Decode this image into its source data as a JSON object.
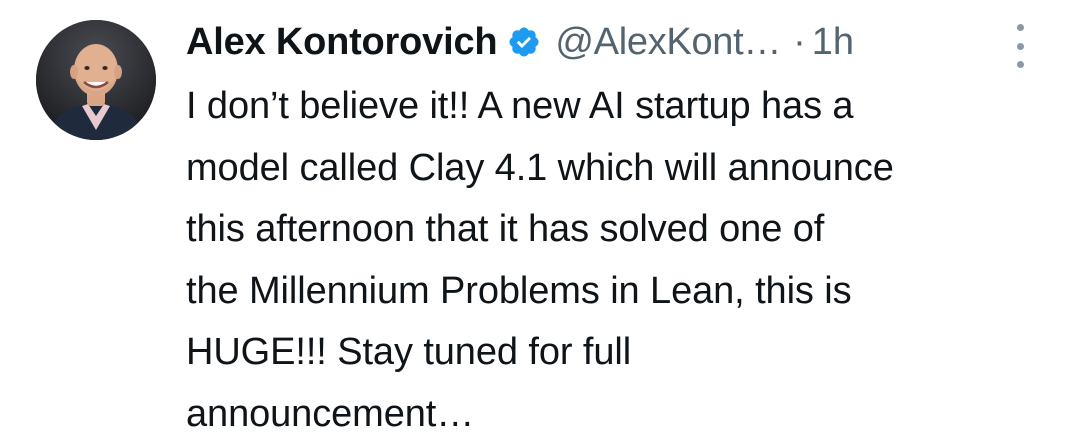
{
  "tweet": {
    "author": {
      "display_name": "Alex Kontorovich",
      "handle": "@AlexKont…",
      "verified": true,
      "verified_color": "#1d9bf0",
      "avatar_icon": "profile-photo"
    },
    "separator": "·",
    "timestamp": "1h",
    "more_icon": "vertical-ellipsis-icon",
    "text_lines": [
      "I don’t believe it!! A new AI startup has a",
      "model called Clay 4.1 which will announce",
      "this afternoon that it has solved one of",
      "the Millennium Problems in Lean, this is",
      "HUGE!!! Stay tuned for full",
      "announcement…"
    ]
  },
  "colors": {
    "text_primary": "#0f1419",
    "text_secondary": "#536471",
    "accent": "#1d9bf0",
    "background": "#ffffff"
  }
}
